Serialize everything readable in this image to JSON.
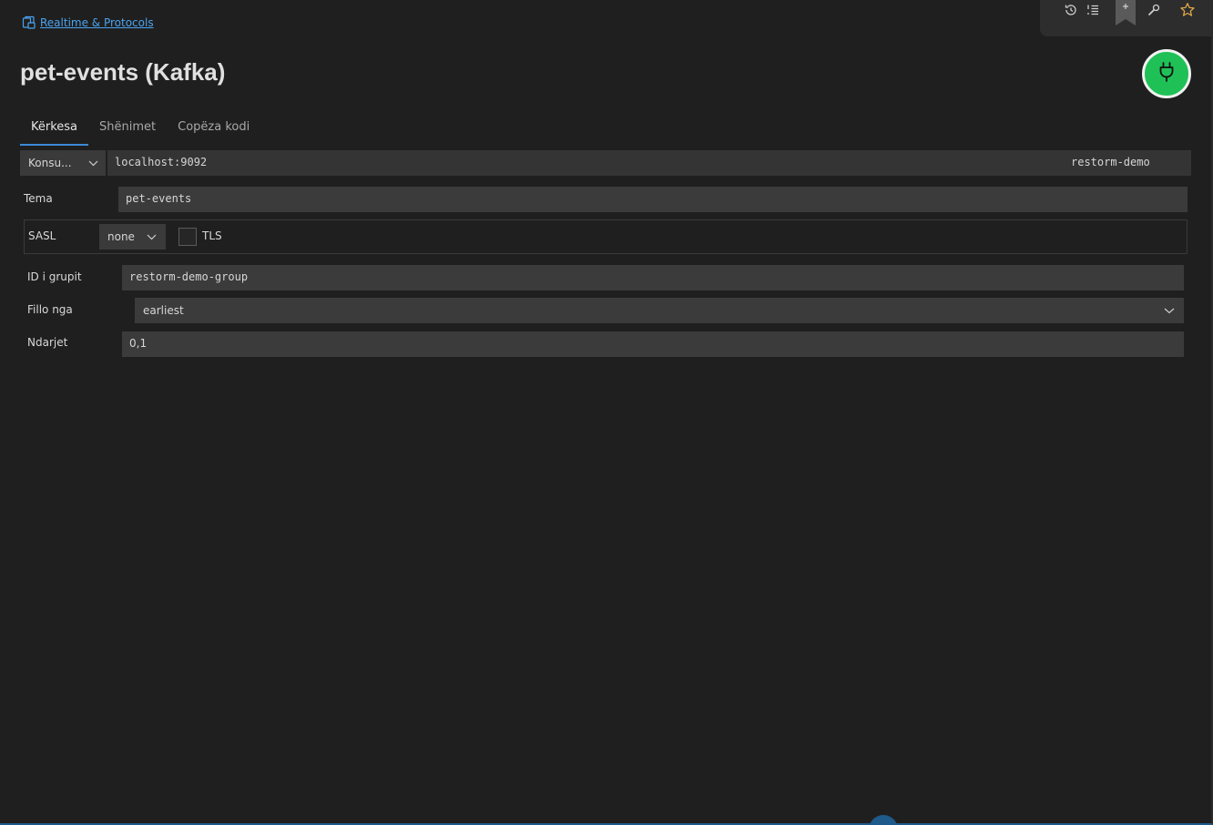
{
  "breadcrumb": {
    "label": "Realtime & Protocols"
  },
  "page": {
    "title": "pet-events (Kafka)"
  },
  "tabs": [
    {
      "label": "Kërkesa",
      "active": true
    },
    {
      "label": "Shënimet",
      "active": false
    },
    {
      "label": "Copëza kodi",
      "active": false
    }
  ],
  "request": {
    "mode": "Konsu...",
    "bootstrap": "localhost:9092",
    "client_id": "restorm-demo"
  },
  "form": {
    "topic_label": "Tema",
    "topic_value": "pet-events",
    "sasl_label": "SASL",
    "sasl_value": "none",
    "tls_label": "TLS",
    "tls_checked": false,
    "group_label": "ID i grupit",
    "group_value": "restorm-demo-group",
    "start_label": "Fillo nga",
    "start_value": "earliest",
    "partitions_label": "Ndarjet",
    "partitions_value": "0,1"
  },
  "icons": {
    "breadcrumb": "collection-icon",
    "history": "history-icon",
    "list": "list-icon",
    "bookmark": "bookmark-add-icon",
    "wrench": "wrench-icon",
    "star": "star-icon",
    "connect": "plug-icon"
  },
  "colors": {
    "accent": "#3c8ad8",
    "link": "#4aa3f0",
    "connect": "#1fc157",
    "star": "#e0a84a",
    "background": "#1f1f1f"
  }
}
